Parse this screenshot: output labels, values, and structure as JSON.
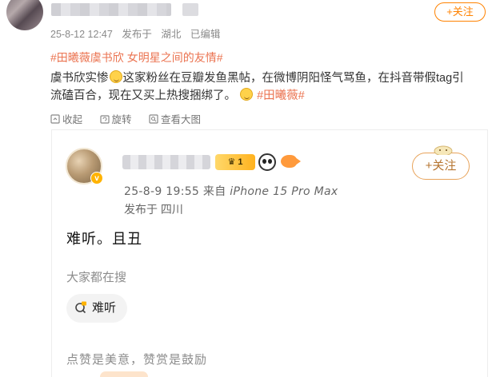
{
  "post": {
    "meta": {
      "date": "25-8-12 12:47",
      "source": "发布于",
      "location": "湖北",
      "edited": "已编辑"
    },
    "follow_label": "+关注",
    "topics": [
      "#田曦薇虞书欣",
      "女明星之间的友情#"
    ],
    "body": {
      "line1_a": "虞书欣实惨",
      "line1_b": "这家粉丝在豆瓣发鱼黑帖，在微博阴阳怪气骂鱼，在抖音带假tag引",
      "line2_a": "流磕百合，现在又买上热搜捆绑了。",
      "line2_topic": "#田曦薇#"
    },
    "actions": {
      "collect": "收起",
      "rotate": "旋转",
      "view_large": "查看大图"
    }
  },
  "card": {
    "level_badge": "1",
    "time": "25-8-9 19:55",
    "from": "来自",
    "device": "iPhone 15 Pro Max",
    "location": "发布于 四川",
    "follow_label": "+关注",
    "content": "难听。且丑",
    "search_hint": "大家都在搜",
    "search_tag": "难听",
    "appreciate": "点赞是美意，赞赏是鼓励"
  },
  "colors": {
    "accent_orange": "#ff8200",
    "topic_color": "#eb7350",
    "meta_gray": "#8a8a8a"
  }
}
